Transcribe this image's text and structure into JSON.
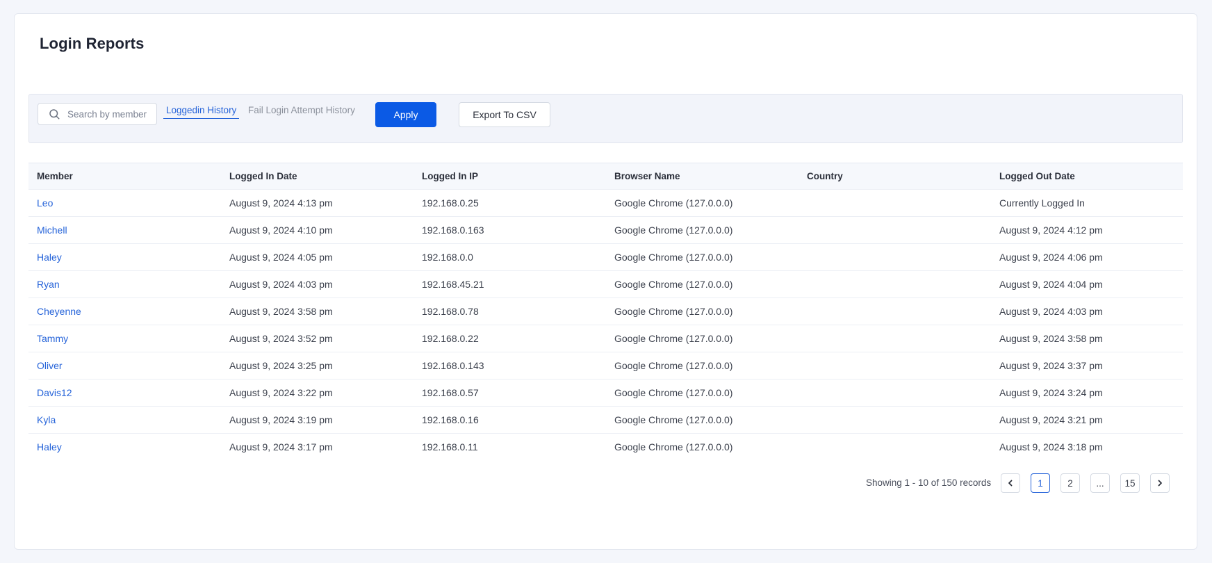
{
  "page": {
    "title": "Login Reports"
  },
  "filters": {
    "search_placeholder": "Search by member",
    "search_value": "",
    "tabs": [
      {
        "label": "Loggedin History",
        "active": true
      },
      {
        "label": "Fail Login Attempt History",
        "active": false
      }
    ],
    "apply_label": "Apply",
    "export_label": "Export To CSV"
  },
  "table": {
    "headers": [
      "Member",
      "Logged In Date",
      "Logged In IP",
      "Browser Name",
      "Country",
      "Logged Out Date"
    ],
    "rows": [
      {
        "member": "Leo",
        "logged_in": "August 9, 2024 4:13 pm",
        "ip": "192.168.0.25",
        "browser": "Google Chrome (127.0.0.0)",
        "country": "",
        "logged_out": "Currently Logged In"
      },
      {
        "member": "Michell",
        "logged_in": "August 9, 2024 4:10 pm",
        "ip": "192.168.0.163",
        "browser": "Google Chrome (127.0.0.0)",
        "country": "",
        "logged_out": "August 9, 2024 4:12 pm"
      },
      {
        "member": "Haley",
        "logged_in": "August 9, 2024 4:05 pm",
        "ip": "192.168.0.0",
        "browser": "Google Chrome (127.0.0.0)",
        "country": "",
        "logged_out": "August 9, 2024 4:06 pm"
      },
      {
        "member": "Ryan",
        "logged_in": "August 9, 2024 4:03 pm",
        "ip": "192.168.45.21",
        "browser": "Google Chrome (127.0.0.0)",
        "country": "",
        "logged_out": "August 9, 2024 4:04 pm"
      },
      {
        "member": "Cheyenne",
        "logged_in": "August 9, 2024 3:58 pm",
        "ip": "192.168.0.78",
        "browser": "Google Chrome (127.0.0.0)",
        "country": "",
        "logged_out": "August 9, 2024 4:03 pm"
      },
      {
        "member": "Tammy",
        "logged_in": "August 9, 2024 3:52 pm",
        "ip": "192.168.0.22",
        "browser": "Google Chrome (127.0.0.0)",
        "country": "",
        "logged_out": "August 9, 2024 3:58 pm"
      },
      {
        "member": "Oliver",
        "logged_in": "August 9, 2024 3:25 pm",
        "ip": "192.168.0.143",
        "browser": "Google Chrome (127.0.0.0)",
        "country": "",
        "logged_out": "August 9, 2024 3:37 pm"
      },
      {
        "member": "Davis12",
        "logged_in": "August 9, 2024 3:22 pm",
        "ip": "192.168.0.57",
        "browser": "Google Chrome (127.0.0.0)",
        "country": "",
        "logged_out": "August 9, 2024 3:24 pm"
      },
      {
        "member": "Kyla",
        "logged_in": "August 9, 2024 3:19 pm",
        "ip": "192.168.0.16",
        "browser": "Google Chrome (127.0.0.0)",
        "country": "",
        "logged_out": "August 9, 2024 3:21 pm"
      },
      {
        "member": "Haley",
        "logged_in": "August 9, 2024 3:17 pm",
        "ip": "192.168.0.11",
        "browser": "Google Chrome (127.0.0.0)",
        "country": "",
        "logged_out": "August 9, 2024 3:18 pm"
      }
    ]
  },
  "pagination": {
    "info": "Showing 1 - 10 of 150 records",
    "pages": [
      "1",
      "2",
      "...",
      "15"
    ],
    "current": "1",
    "prev_icon": "chevron-left-icon",
    "next_icon": "chevron-right-icon"
  },
  "colors": {
    "accent": "#0b5ae5",
    "link": "#2563d9",
    "background": "#f4f6fb"
  }
}
